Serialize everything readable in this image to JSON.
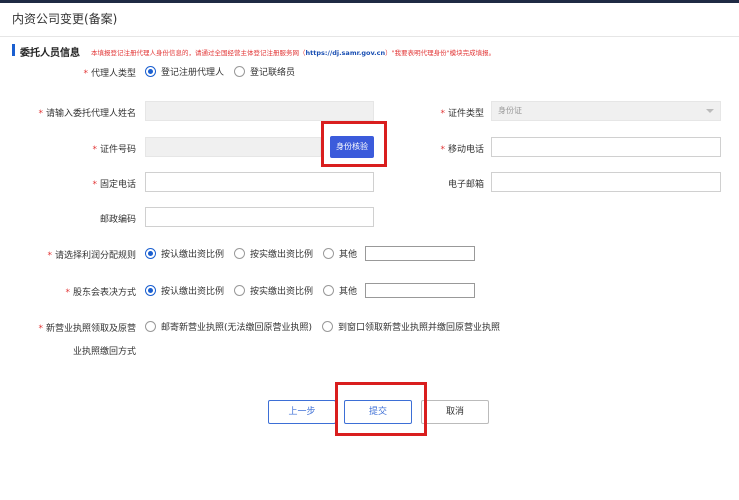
{
  "page": {
    "title": "内资公司变更(备案)"
  },
  "section": {
    "title": "委托人员信息",
    "note_prefix": "本填报登记注册代理人身份信息的，请通过全国经营主体登记注册服务网（",
    "note_link": "https://dj.samr.gov.cn",
    "note_suffix": "）\"我要表明代理身份\"模块完成填报。"
  },
  "agent_type": {
    "label": "代理人类型",
    "options": [
      "登记注册代理人",
      "登记联络员"
    ],
    "selected": 0
  },
  "fields": {
    "name_label": "请输入委托代理人姓名",
    "id_type_label": "证件类型",
    "id_type_value": "身份证",
    "id_number_label": "证件号码",
    "verify_button": "身份核验",
    "mobile_label": "移动电话",
    "landline_label": "固定电话",
    "email_label": "电子邮箱",
    "postcode_label": "邮政编码"
  },
  "profit_rule": {
    "label": "请选择利润分配规则",
    "options": [
      "按认缴出资比例",
      "按实缴出资比例",
      "其他"
    ],
    "selected": 0
  },
  "vote_method": {
    "label": "股东会表决方式",
    "options": [
      "按认缴出资比例",
      "按实缴出资比例",
      "其他"
    ],
    "selected": 0
  },
  "license": {
    "label_line1": "新营业执照领取及原营",
    "label_line2": "业执照缴回方式",
    "options": [
      "邮寄新营业执照(无法缴回原营业执照)",
      "到窗口领取新营业执照并缴回原营业执照"
    ],
    "selected": -1
  },
  "buttons": {
    "prev": "上一步",
    "submit": "提交",
    "cancel": "取消"
  },
  "colors": {
    "accent": "#3b5bdb",
    "required": "#e23636",
    "highlight_box": "#d91e1e"
  }
}
